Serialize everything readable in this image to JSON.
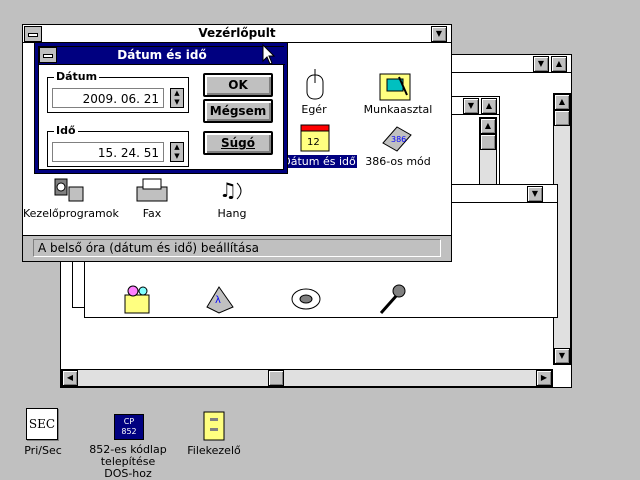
{
  "desktop_icons": [
    {
      "label": "Pri/Sec",
      "icon": "pri-sec-icon"
    },
    {
      "label": "852-es kódlap telepítése DOS-hoz",
      "icon": "codepage-icon",
      "glyph": "CP\n852"
    },
    {
      "label": "Filekezelő",
      "icon": "file-manager-icon"
    }
  ],
  "pri_sec_glyph": "SEC",
  "control_panel": {
    "title": "Vezérlőpult",
    "icons": [
      {
        "label": "Egér",
        "icon": "mouse-icon"
      },
      {
        "label": "Munkaasztal",
        "icon": "desktop-icon"
      },
      {
        "label": "Dátum és idő",
        "icon": "date-time-icon",
        "selected": true
      },
      {
        "label": "386-os mód",
        "icon": "386-enhanced-icon",
        "glyph": "386"
      },
      {
        "label": "Kezelőprogramok",
        "icon": "drivers-icon"
      },
      {
        "label": "Fax",
        "icon": "fax-icon"
      },
      {
        "label": "Hang",
        "icon": "sound-icon"
      }
    ],
    "status": "A belső óra (dátum és idő) beállítása"
  },
  "dialog": {
    "title": "Dátum és idő",
    "date_label": "Dátum",
    "date_value": "2009. 06. 21",
    "time_label": "Idő",
    "time_value": "15. 24. 51",
    "ok": "OK",
    "cancel": "Mégsem",
    "help": "Súgó"
  },
  "back_group_icons": [
    {
      "icon": "accessories-icon"
    },
    {
      "icon": "math-icon"
    },
    {
      "icon": "film-reel-icon"
    },
    {
      "icon": "microphone-icon"
    }
  ],
  "colors": {
    "desktop": "#c0c0c0",
    "active_title": "#000080",
    "selection": "#000080"
  }
}
